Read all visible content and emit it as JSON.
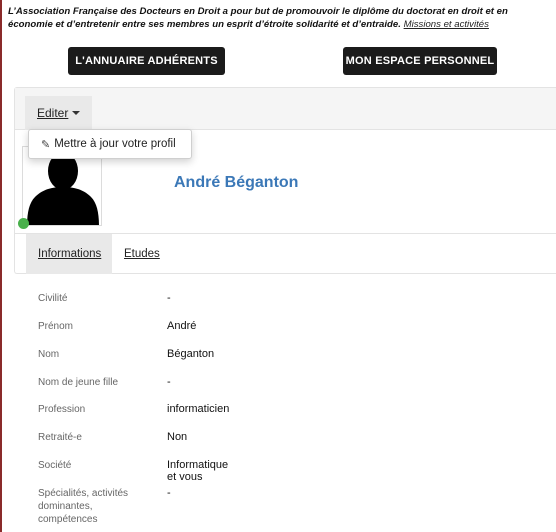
{
  "intro": {
    "text": "L’Association Française des Docteurs en Droit a pour but de promouvoir le diplôme du doctorat en droit et en économie et d’entretenir entre ses membres un esprit d’étroite solidarité et d’entraide.",
    "line1": "L’Association Française des Docteurs en Droit a pour but de promouvoir le diplôme du doctorat en droit et en",
    "line2": "économie et d’entretenir entre ses membres un esprit d’étroite solidarité et d’entraide.",
    "link": "Missions et activités"
  },
  "buttons": {
    "annuaire": "L'ANNUAIRE ADHÉRENTS",
    "espace": "MON ESPACE PERSONNEL"
  },
  "toolbar": {
    "edit_label": "Editer"
  },
  "dropdown": {
    "item": "Mettre à jour votre profil"
  },
  "profile": {
    "name": "André Béganton",
    "status_color": "#49b04b"
  },
  "tabs": [
    "Informations",
    "Etudes"
  ],
  "fields": [
    {
      "label": "Civilité",
      "value": "-"
    },
    {
      "label": "Prénom",
      "value": "André"
    },
    {
      "label": "Nom",
      "value": "Béganton"
    },
    {
      "label": "Nom de jeune fille",
      "value": "-"
    },
    {
      "label": "Profession",
      "value": "informaticien"
    },
    {
      "label": "Retraité-e",
      "value": "Non"
    },
    {
      "label": "Société",
      "value": "Informatique et vous"
    },
    {
      "label": "Spécialités, activités dominantes, compétences",
      "value": "-"
    }
  ],
  "colors": {
    "accent": "#3b78b7",
    "dark_button": "#1b1b1b",
    "left_rule": "#8a2a2a"
  }
}
